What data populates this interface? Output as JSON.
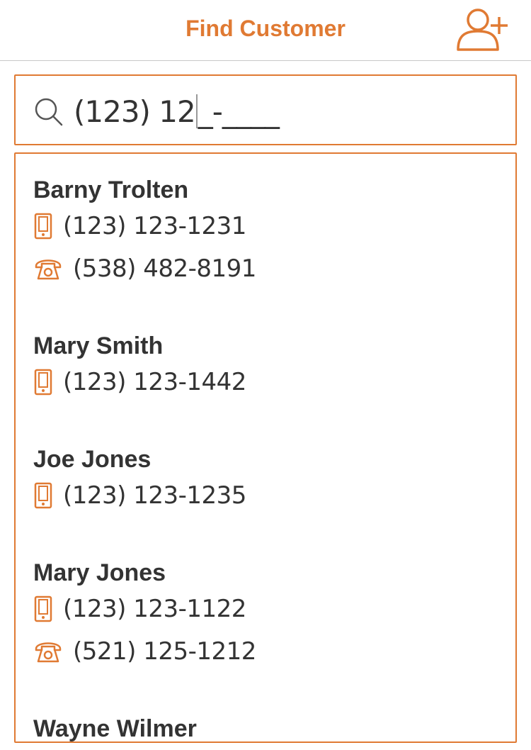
{
  "header": {
    "title": "Find Customer",
    "add_icon": "add-user-icon"
  },
  "search": {
    "value_typed": "(123) 12",
    "value_mask": "_-____",
    "icon": "search-icon"
  },
  "customers": [
    {
      "name": "Barny Trolten",
      "phones": [
        {
          "type": "mobile",
          "icon": "mobile-phone-icon",
          "number": "(123) 123-1231"
        },
        {
          "type": "landline",
          "icon": "landline-phone-icon",
          "number": "(538) 482-8191"
        }
      ]
    },
    {
      "name": "Mary Smith",
      "phones": [
        {
          "type": "mobile",
          "icon": "mobile-phone-icon",
          "number": "(123) 123-1442"
        }
      ]
    },
    {
      "name": "Joe Jones",
      "phones": [
        {
          "type": "mobile",
          "icon": "mobile-phone-icon",
          "number": "(123) 123-1235"
        }
      ]
    },
    {
      "name": "Mary Jones",
      "phones": [
        {
          "type": "mobile",
          "icon": "mobile-phone-icon",
          "number": "(123) 123-1122"
        },
        {
          "type": "landline",
          "icon": "landline-phone-icon",
          "number": "(521) 125-1212"
        }
      ]
    },
    {
      "name": "Wayne Wilmer",
      "phones": []
    }
  ],
  "colors": {
    "accent": "#e07a33",
    "text": "#333333",
    "divider": "#c8c8c8"
  }
}
